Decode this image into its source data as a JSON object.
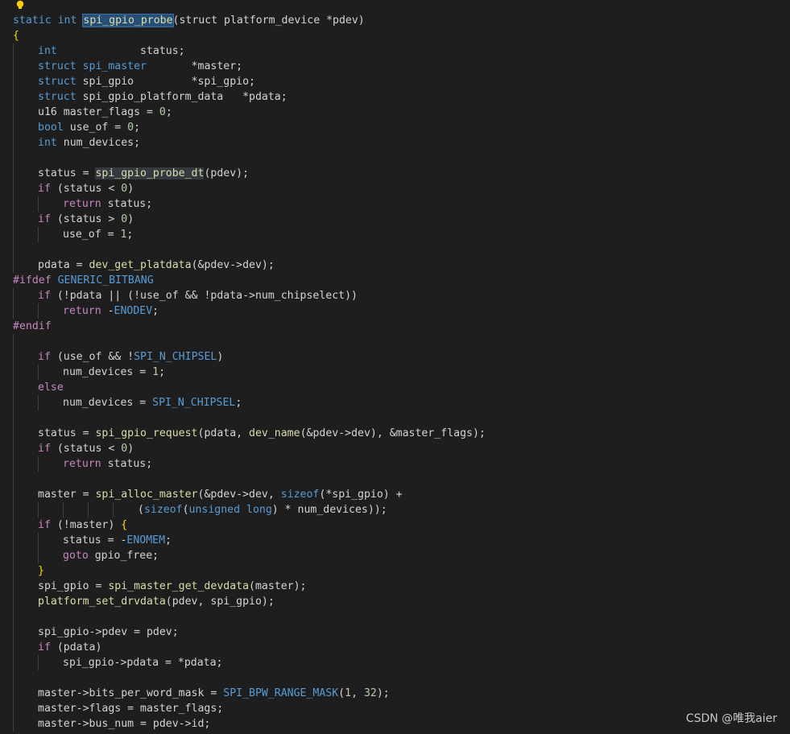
{
  "editor": {
    "language": "c",
    "function_name": "spi_gpio_probe",
    "colors": {
      "background": "#1e1e1e",
      "keyword": "#569cd6",
      "control": "#c586c0",
      "function": "#dcdcaa",
      "macro": "#569cd6",
      "number": "#b5cea8",
      "plain": "#d4d4d4",
      "brace": "#ffd700"
    },
    "lines": [
      {
        "indent": 0,
        "tokens": [
          [
            "kw",
            "static"
          ],
          [
            "p",
            " "
          ],
          [
            "kw",
            "int"
          ],
          [
            "p",
            " "
          ],
          [
            "fnsel",
            "spi_gpio_probe"
          ],
          [
            "p",
            "(struct platform_device *pdev)"
          ]
        ]
      },
      {
        "indent": 0,
        "tokens": [
          [
            "br",
            "{"
          ]
        ]
      },
      {
        "indent": 1,
        "tokens": [
          [
            "kw",
            "int"
          ],
          [
            "p",
            "             status;"
          ]
        ]
      },
      {
        "indent": 1,
        "tokens": [
          [
            "kw",
            "struct"
          ],
          [
            "p",
            " "
          ],
          [
            "kw",
            "spi_master"
          ],
          [
            "p",
            "       *master;"
          ]
        ]
      },
      {
        "indent": 1,
        "tokens": [
          [
            "kw",
            "struct"
          ],
          [
            "p",
            " spi_gpio         *spi_gpio;"
          ]
        ]
      },
      {
        "indent": 1,
        "tokens": [
          [
            "kw",
            "struct"
          ],
          [
            "p",
            " spi_gpio_platform_data   *pdata;"
          ]
        ]
      },
      {
        "indent": 1,
        "tokens": [
          [
            "p",
            "u16 master_flags = "
          ],
          [
            "num",
            "0"
          ],
          [
            "p",
            ";"
          ]
        ]
      },
      {
        "indent": 1,
        "tokens": [
          [
            "kw",
            "bool"
          ],
          [
            "p",
            " use_of = "
          ],
          [
            "num",
            "0"
          ],
          [
            "p",
            ";"
          ]
        ]
      },
      {
        "indent": 1,
        "tokens": [
          [
            "kw",
            "int"
          ],
          [
            "p",
            " num_devices;"
          ]
        ]
      },
      {
        "indent": 1,
        "tokens": []
      },
      {
        "indent": 1,
        "tokens": [
          [
            "p",
            "status = "
          ],
          [
            "fnref",
            "spi_gpio_probe_dt"
          ],
          [
            "p",
            "(pdev);"
          ]
        ]
      },
      {
        "indent": 1,
        "tokens": [
          [
            "ctl",
            "if"
          ],
          [
            "p",
            " (status < "
          ],
          [
            "num",
            "0"
          ],
          [
            "p",
            ")"
          ]
        ]
      },
      {
        "indent": 2,
        "tokens": [
          [
            "ctl",
            "return"
          ],
          [
            "p",
            " status;"
          ]
        ]
      },
      {
        "indent": 1,
        "tokens": [
          [
            "ctl",
            "if"
          ],
          [
            "p",
            " (status > "
          ],
          [
            "num",
            "0"
          ],
          [
            "p",
            ")"
          ]
        ]
      },
      {
        "indent": 2,
        "tokens": [
          [
            "p",
            "use_of = "
          ],
          [
            "num",
            "1"
          ],
          [
            "p",
            ";"
          ]
        ]
      },
      {
        "indent": 1,
        "tokens": []
      },
      {
        "indent": 1,
        "tokens": [
          [
            "p",
            "pdata = "
          ],
          [
            "fn",
            "dev_get_platdata"
          ],
          [
            "p",
            "(&pdev->dev);"
          ]
        ]
      },
      {
        "indent": 0,
        "tokens": [
          [
            "ctl",
            "#ifdef"
          ],
          [
            "p",
            " "
          ],
          [
            "mac",
            "GENERIC_BITBANG"
          ]
        ]
      },
      {
        "indent": 1,
        "tokens": [
          [
            "ctl",
            "if"
          ],
          [
            "p",
            " (!pdata || (!use_of && !pdata->num_chipselect))"
          ]
        ]
      },
      {
        "indent": 2,
        "tokens": [
          [
            "ctl",
            "return"
          ],
          [
            "p",
            " -"
          ],
          [
            "mac",
            "ENODEV"
          ],
          [
            "p",
            ";"
          ]
        ]
      },
      {
        "indent": 0,
        "tokens": [
          [
            "ctl",
            "#endif"
          ]
        ]
      },
      {
        "indent": 1,
        "tokens": []
      },
      {
        "indent": 1,
        "tokens": [
          [
            "ctl",
            "if"
          ],
          [
            "p",
            " (use_of && !"
          ],
          [
            "mac",
            "SPI_N_CHIPSEL"
          ],
          [
            "p",
            ")"
          ]
        ]
      },
      {
        "indent": 2,
        "tokens": [
          [
            "p",
            "num_devices = "
          ],
          [
            "num",
            "1"
          ],
          [
            "p",
            ";"
          ]
        ]
      },
      {
        "indent": 1,
        "tokens": [
          [
            "ctl",
            "else"
          ]
        ]
      },
      {
        "indent": 2,
        "tokens": [
          [
            "p",
            "num_devices = "
          ],
          [
            "mac",
            "SPI_N_CHIPSEL"
          ],
          [
            "p",
            ";"
          ]
        ]
      },
      {
        "indent": 1,
        "tokens": []
      },
      {
        "indent": 1,
        "tokens": [
          [
            "p",
            "status = "
          ],
          [
            "fn",
            "spi_gpio_request"
          ],
          [
            "p",
            "(pdata, "
          ],
          [
            "fn",
            "dev_name"
          ],
          [
            "p",
            "(&pdev->dev), &master_flags);"
          ]
        ]
      },
      {
        "indent": 1,
        "tokens": [
          [
            "ctl",
            "if"
          ],
          [
            "p",
            " (status < "
          ],
          [
            "num",
            "0"
          ],
          [
            "p",
            ")"
          ]
        ]
      },
      {
        "indent": 2,
        "tokens": [
          [
            "ctl",
            "return"
          ],
          [
            "p",
            " status;"
          ]
        ]
      },
      {
        "indent": 1,
        "tokens": []
      },
      {
        "indent": 1,
        "tokens": [
          [
            "p",
            "master = "
          ],
          [
            "fn",
            "spi_alloc_master"
          ],
          [
            "p",
            "(&pdev->dev, "
          ],
          [
            "kw",
            "sizeof"
          ],
          [
            "p",
            "(*spi_gpio) +"
          ]
        ]
      },
      {
        "indent": 5,
        "tokens": [
          [
            "p",
            "("
          ],
          [
            "kw",
            "sizeof"
          ],
          [
            "p",
            "("
          ],
          [
            "kw",
            "unsigned long"
          ],
          [
            "p",
            ") * num_devices));"
          ]
        ]
      },
      {
        "indent": 1,
        "tokens": [
          [
            "ctl",
            "if"
          ],
          [
            "p",
            " (!master) "
          ],
          [
            "br",
            "{"
          ]
        ]
      },
      {
        "indent": 2,
        "tokens": [
          [
            "p",
            "status = -"
          ],
          [
            "mac",
            "ENOMEM"
          ],
          [
            "p",
            ";"
          ]
        ]
      },
      {
        "indent": 2,
        "tokens": [
          [
            "ctl",
            "goto"
          ],
          [
            "p",
            " gpio_free;"
          ]
        ]
      },
      {
        "indent": 1,
        "tokens": [
          [
            "br",
            "}"
          ]
        ]
      },
      {
        "indent": 1,
        "tokens": [
          [
            "p",
            "spi_gpio = "
          ],
          [
            "fn",
            "spi_master_get_devdata"
          ],
          [
            "p",
            "(master);"
          ]
        ]
      },
      {
        "indent": 1,
        "tokens": [
          [
            "fn",
            "platform_set_drvdata"
          ],
          [
            "p",
            "(pdev, spi_gpio);"
          ]
        ]
      },
      {
        "indent": 1,
        "tokens": []
      },
      {
        "indent": 1,
        "tokens": [
          [
            "p",
            "spi_gpio->pdev = pdev;"
          ]
        ]
      },
      {
        "indent": 1,
        "tokens": [
          [
            "ctl",
            "if"
          ],
          [
            "p",
            " (pdata)"
          ]
        ]
      },
      {
        "indent": 2,
        "tokens": [
          [
            "p",
            "spi_gpio->pdata = *pdata;"
          ]
        ]
      },
      {
        "indent": 1,
        "tokens": []
      },
      {
        "indent": 1,
        "tokens": [
          [
            "p",
            "master->bits_per_word_mask = "
          ],
          [
            "mac",
            "SPI_BPW_RANGE_MASK"
          ],
          [
            "p",
            "("
          ],
          [
            "num",
            "1"
          ],
          [
            "p",
            ", "
          ],
          [
            "num",
            "32"
          ],
          [
            "p",
            ");"
          ]
        ]
      },
      {
        "indent": 1,
        "tokens": [
          [
            "p",
            "master->flags = master_flags;"
          ]
        ]
      },
      {
        "indent": 1,
        "tokens": [
          [
            "p",
            "master->bus_num = pdev->id;"
          ]
        ]
      }
    ]
  },
  "lightbulb_icon": "lightbulb-icon",
  "watermark": "CSDN @唯我aier"
}
